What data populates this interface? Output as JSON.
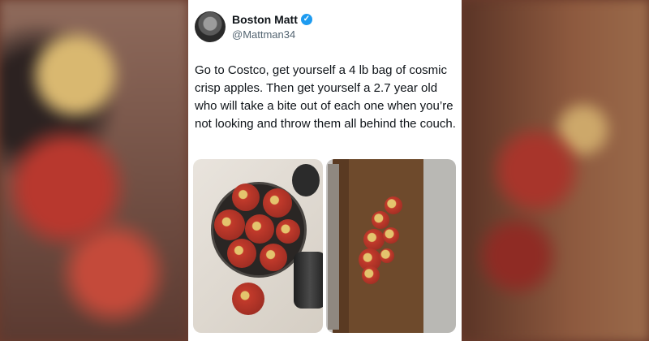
{
  "tweet": {
    "author_name": "Boston Matt",
    "author_handle": "@Mattman34",
    "verified": true,
    "text": "Go to Costco, get yourself a 4 lb bag of cosmic crisp apples. Then get yourself a 2.7 year old who will take a bite out of each one when you’re not looking and throw them all behind the couch."
  },
  "media": [
    {
      "description_icon": "photo-icon"
    },
    {
      "description_icon": "photo-icon"
    }
  ],
  "colors": {
    "card_bg": "#ffffff",
    "text_primary": "#0f1419",
    "text_secondary": "#536471",
    "verified_blue": "#1d9bf0"
  }
}
